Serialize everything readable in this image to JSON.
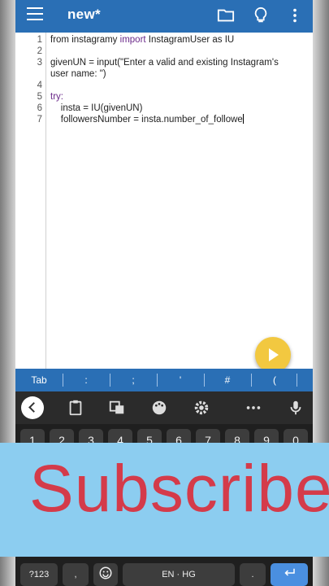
{
  "appbar": {
    "title": "new*",
    "icons": [
      "menu-icon",
      "folder-icon",
      "lightbulb-icon",
      "more-vert-icon"
    ]
  },
  "editor": {
    "lines": [
      {
        "num": "1",
        "pre": "from instagramy ",
        "kw": "import",
        "post": " InstagramUser as IU"
      },
      {
        "num": "2",
        "pre": "",
        "kw": "",
        "post": ""
      },
      {
        "num": "3",
        "pre": "givenUN = input(\"Enter a valid and existing Instagram's",
        "kw": "",
        "post": ""
      },
      {
        "num": "",
        "pre": "user name: \")",
        "kw": "",
        "post": ""
      },
      {
        "num": "4",
        "pre": "",
        "kw": "",
        "post": ""
      },
      {
        "num": "5",
        "pre": "",
        "kw": "try:",
        "post": ""
      },
      {
        "num": "6",
        "pre": "    insta = IU(givenUN)",
        "kw": "",
        "post": ""
      },
      {
        "num": "7",
        "pre": "    followersNumber = insta.number_of_followe",
        "kw": "",
        "post": ""
      }
    ]
  },
  "symbols": [
    "Tab",
    ":",
    ";",
    "'",
    "#",
    "("
  ],
  "keyboard": {
    "numbers": [
      "1",
      "2",
      "3",
      "4",
      "5",
      "6",
      "7",
      "8",
      "9",
      "0"
    ],
    "mode_key": "?123",
    "comma_key": ",",
    "space_key": "EN · HG",
    "period_key": "."
  },
  "banner": {
    "text": "Subscribe"
  },
  "colors": {
    "primary": "#2a6fb5",
    "fab": "#f2c840",
    "banner_bg": "#8ccdf0",
    "banner_text": "#d43b4a"
  }
}
